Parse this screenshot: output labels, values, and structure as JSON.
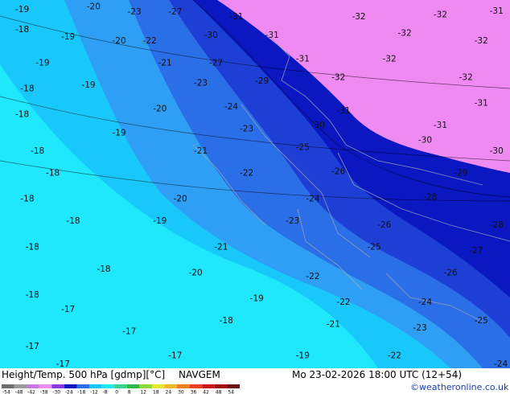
{
  "map": {
    "colors": {
      "cyan_warm": "#1fe8fd",
      "cyan": "#18c8fb",
      "sky": "#2f9ff5",
      "blue": "#2b6fe8",
      "royal": "#1e3fd6",
      "navy": "#0b18c2",
      "pink": "#f08af3"
    },
    "contour_labels": [
      {
        "text": "-19",
        "fx": 0.03,
        "fy": 0.015
      },
      {
        "text": "-20",
        "fx": 0.17,
        "fy": 0.008
      },
      {
        "text": "-23",
        "fx": 0.25,
        "fy": 0.022
      },
      {
        "text": "-27",
        "fx": 0.33,
        "fy": 0.022
      },
      {
        "text": "-31",
        "fx": 0.45,
        "fy": 0.035
      },
      {
        "text": "-32",
        "fx": 0.69,
        "fy": 0.035
      },
      {
        "text": "-32",
        "fx": 0.85,
        "fy": 0.03
      },
      {
        "text": "-31",
        "fx": 0.96,
        "fy": 0.02
      },
      {
        "text": "-18",
        "fx": 0.03,
        "fy": 0.07
      },
      {
        "text": "-19",
        "fx": 0.12,
        "fy": 0.09
      },
      {
        "text": "-20",
        "fx": 0.22,
        "fy": 0.1
      },
      {
        "text": "-22",
        "fx": 0.28,
        "fy": 0.1
      },
      {
        "text": "-30",
        "fx": 0.4,
        "fy": 0.085
      },
      {
        "text": "-31",
        "fx": 0.52,
        "fy": 0.085
      },
      {
        "text": "-32",
        "fx": 0.78,
        "fy": 0.08
      },
      {
        "text": "-32",
        "fx": 0.93,
        "fy": 0.1
      },
      {
        "text": "-19",
        "fx": 0.07,
        "fy": 0.16
      },
      {
        "text": "-21",
        "fx": 0.31,
        "fy": 0.16
      },
      {
        "text": "-27",
        "fx": 0.41,
        "fy": 0.16
      },
      {
        "text": "-31",
        "fx": 0.58,
        "fy": 0.15
      },
      {
        "text": "-32",
        "fx": 0.75,
        "fy": 0.15
      },
      {
        "text": "-18",
        "fx": 0.04,
        "fy": 0.23
      },
      {
        "text": "-19",
        "fx": 0.16,
        "fy": 0.22
      },
      {
        "text": "-23",
        "fx": 0.38,
        "fy": 0.215
      },
      {
        "text": "-29",
        "fx": 0.5,
        "fy": 0.21
      },
      {
        "text": "-32",
        "fx": 0.65,
        "fy": 0.2
      },
      {
        "text": "-32",
        "fx": 0.9,
        "fy": 0.2
      },
      {
        "text": "-18",
        "fx": 0.03,
        "fy": 0.3
      },
      {
        "text": "-20",
        "fx": 0.3,
        "fy": 0.285
      },
      {
        "text": "-24",
        "fx": 0.44,
        "fy": 0.28
      },
      {
        "text": "-31",
        "fx": 0.66,
        "fy": 0.29
      },
      {
        "text": "-31",
        "fx": 0.93,
        "fy": 0.27
      },
      {
        "text": "-19",
        "fx": 0.22,
        "fy": 0.35
      },
      {
        "text": "-23",
        "fx": 0.47,
        "fy": 0.34
      },
      {
        "text": "-30",
        "fx": 0.61,
        "fy": 0.33
      },
      {
        "text": "-31",
        "fx": 0.85,
        "fy": 0.33
      },
      {
        "text": "-18",
        "fx": 0.06,
        "fy": 0.4
      },
      {
        "text": "-21",
        "fx": 0.38,
        "fy": 0.4
      },
      {
        "text": "-25",
        "fx": 0.58,
        "fy": 0.39
      },
      {
        "text": "-30",
        "fx": 0.82,
        "fy": 0.37
      },
      {
        "text": "-30",
        "fx": 0.96,
        "fy": 0.4
      },
      {
        "text": "-18",
        "fx": 0.09,
        "fy": 0.46
      },
      {
        "text": "-22",
        "fx": 0.47,
        "fy": 0.46
      },
      {
        "text": "-26",
        "fx": 0.65,
        "fy": 0.455
      },
      {
        "text": "-29",
        "fx": 0.89,
        "fy": 0.46
      },
      {
        "text": "-18",
        "fx": 0.04,
        "fy": 0.53
      },
      {
        "text": "-20",
        "fx": 0.34,
        "fy": 0.53
      },
      {
        "text": "-24",
        "fx": 0.6,
        "fy": 0.53
      },
      {
        "text": "-28",
        "fx": 0.83,
        "fy": 0.525
      },
      {
        "text": "-18",
        "fx": 0.13,
        "fy": 0.59
      },
      {
        "text": "-19",
        "fx": 0.3,
        "fy": 0.59
      },
      {
        "text": "-23",
        "fx": 0.56,
        "fy": 0.59
      },
      {
        "text": "-26",
        "fx": 0.74,
        "fy": 0.6
      },
      {
        "text": "-28",
        "fx": 0.96,
        "fy": 0.6
      },
      {
        "text": "-18",
        "fx": 0.05,
        "fy": 0.66
      },
      {
        "text": "-21",
        "fx": 0.42,
        "fy": 0.66
      },
      {
        "text": "-25",
        "fx": 0.72,
        "fy": 0.66
      },
      {
        "text": "-27",
        "fx": 0.92,
        "fy": 0.67
      },
      {
        "text": "-18",
        "fx": 0.19,
        "fy": 0.72
      },
      {
        "text": "-20",
        "fx": 0.37,
        "fy": 0.73
      },
      {
        "text": "-22",
        "fx": 0.6,
        "fy": 0.74
      },
      {
        "text": "-26",
        "fx": 0.87,
        "fy": 0.73
      },
      {
        "text": "-18",
        "fx": 0.05,
        "fy": 0.79
      },
      {
        "text": "-17",
        "fx": 0.12,
        "fy": 0.83
      },
      {
        "text": "-19",
        "fx": 0.49,
        "fy": 0.8
      },
      {
        "text": "-22",
        "fx": 0.66,
        "fy": 0.81
      },
      {
        "text": "-24",
        "fx": 0.82,
        "fy": 0.81
      },
      {
        "text": "-17",
        "fx": 0.24,
        "fy": 0.89
      },
      {
        "text": "-18",
        "fx": 0.43,
        "fy": 0.86
      },
      {
        "text": "-21",
        "fx": 0.64,
        "fy": 0.87
      },
      {
        "text": "-23",
        "fx": 0.81,
        "fy": 0.88
      },
      {
        "text": "-25",
        "fx": 0.93,
        "fy": 0.86
      },
      {
        "text": "-17",
        "fx": 0.05,
        "fy": 0.93
      },
      {
        "text": "-17",
        "fx": 0.33,
        "fy": 0.955
      },
      {
        "text": "-19",
        "fx": 0.58,
        "fy": 0.955
      },
      {
        "text": "-22",
        "fx": 0.76,
        "fy": 0.955
      },
      {
        "text": "-24",
        "fx": 0.97,
        "fy": 0.98
      },
      {
        "text": "-17",
        "fx": 0.11,
        "fy": 0.99
      }
    ]
  },
  "footer": {
    "title": "Height/Temp. 500 hPa [gdmp][°C]",
    "model": "NAVGEM",
    "datetime": "Mo 23-02-2026 18:00 UTC (12+54)",
    "credit": "©weatheronline.co.uk",
    "scale_ticks": [
      "-54",
      "-48",
      "-42",
      "-38",
      "-30",
      "-24",
      "-18",
      "-12",
      "-8",
      "0",
      "8",
      "12",
      "18",
      "24",
      "30",
      "36",
      "42",
      "48",
      "54"
    ],
    "scale_colors": [
      "#6e6e6e",
      "#9a9a9a",
      "#c77ae0",
      "#f08af3",
      "#8a3ae0",
      "#0b18c2",
      "#2b6fe8",
      "#18c8fb",
      "#1fe8fd",
      "#3ad28a",
      "#2fb848",
      "#8ad83a",
      "#e8e830",
      "#f0b828",
      "#f08020",
      "#e84020",
      "#c81818",
      "#a01010",
      "#701010"
    ]
  }
}
